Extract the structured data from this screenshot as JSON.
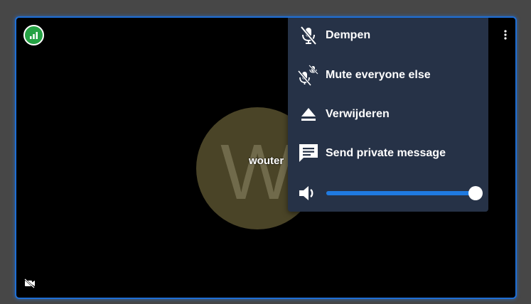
{
  "participant": {
    "avatar_initial": "W",
    "display_name": "wouter"
  },
  "connection": {
    "icon": "signal-bars-icon",
    "status_color": "#25a244"
  },
  "camera": {
    "icon": "camera-off-icon"
  },
  "menu": {
    "items": [
      {
        "label": "Dempen",
        "icon": "mic-off-icon"
      },
      {
        "label": "Mute everyone else",
        "icon": "mute-others-icon"
      },
      {
        "label": "Verwijderen",
        "icon": "eject-icon"
      },
      {
        "label": "Send private message",
        "icon": "message-icon"
      }
    ],
    "volume": {
      "icon": "volume-icon",
      "level": 1.0
    }
  },
  "colors": {
    "accent": "#1f7ae0",
    "menu_bg": "#263247",
    "tile_border": "#1e6fd6",
    "avatar_bg": "#4a4427"
  }
}
